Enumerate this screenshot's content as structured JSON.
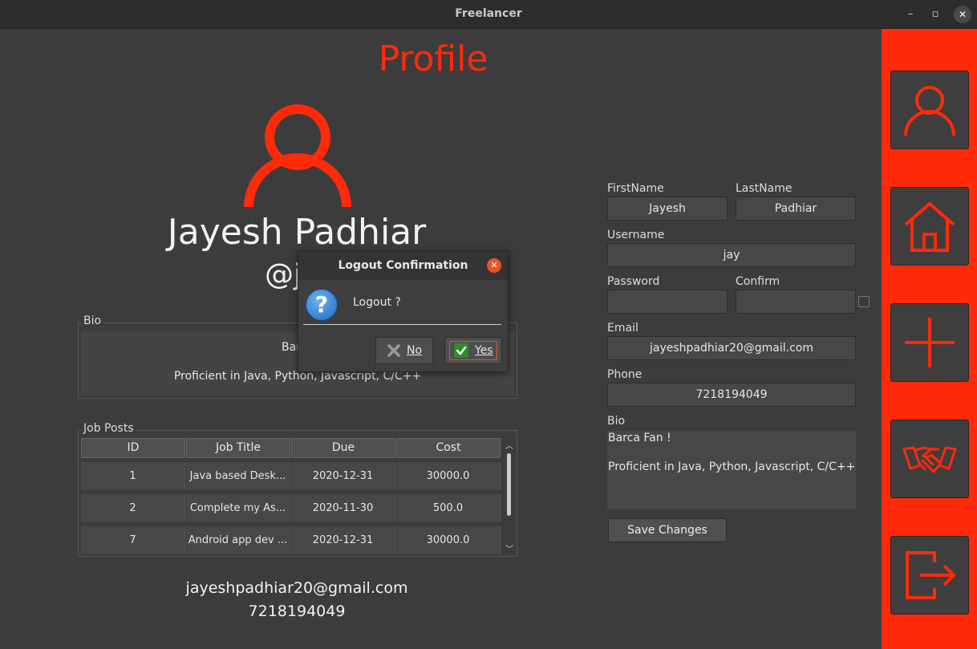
{
  "window": {
    "title": "Freelancer",
    "minimize": "–",
    "maximize": "▫",
    "close": "✕"
  },
  "colors": {
    "accent": "#ff2a0a",
    "background": "#3c3c3c",
    "field": "#474747"
  },
  "profile": {
    "heading": "Profile",
    "full_name": "Jayesh Padhiar",
    "handle": "@j",
    "bio_label": "Bio",
    "bio_lines": [
      "Barca",
      "Proficient in Java, Python, Javascript, C/C++"
    ],
    "email": "jayeshpadhiar20@gmail.com",
    "phone": "7218194049"
  },
  "job_posts": {
    "label": "Job Posts",
    "columns": [
      "ID",
      "Job Title",
      "Due",
      "Cost"
    ],
    "rows": [
      [
        "1",
        "Java based Desk...",
        "2020-12-31",
        "30000.0"
      ],
      [
        "2",
        "Complete my As...",
        "2020-11-30",
        "500.0"
      ],
      [
        "7",
        "Android app dev ...",
        "2020-12-31",
        "30000.0"
      ]
    ]
  },
  "form": {
    "firstname_label": "FirstName",
    "firstname_value": "Jayesh",
    "lastname_label": "LastName",
    "lastname_value": "Padhiar",
    "username_label": "Username",
    "username_value": "jay",
    "password_label": "Password",
    "password_value": "",
    "confirm_label": "Confirm",
    "confirm_value": "",
    "email_label": "Email",
    "email_value": "jayeshpadhiar20@gmail.com",
    "phone_label": "Phone",
    "phone_value": "7218194049",
    "bio_label": "Bio",
    "bio_lines": [
      "Barca Fan !",
      "",
      "Proficient in Java, Python, Javascript, C/C++"
    ],
    "save_label": "Save Changes"
  },
  "sidebar": {
    "items": [
      {
        "icon": "user-icon"
      },
      {
        "icon": "home-icon"
      },
      {
        "icon": "plus-icon"
      },
      {
        "icon": "handshake-icon"
      },
      {
        "icon": "logout-icon"
      }
    ]
  },
  "dialog": {
    "title": "Logout Confirmation",
    "close": "✕",
    "icon": "question-icon",
    "icon_glyph": "?",
    "message": "Logout ?",
    "no_label": "No",
    "yes_label": "Yes"
  }
}
